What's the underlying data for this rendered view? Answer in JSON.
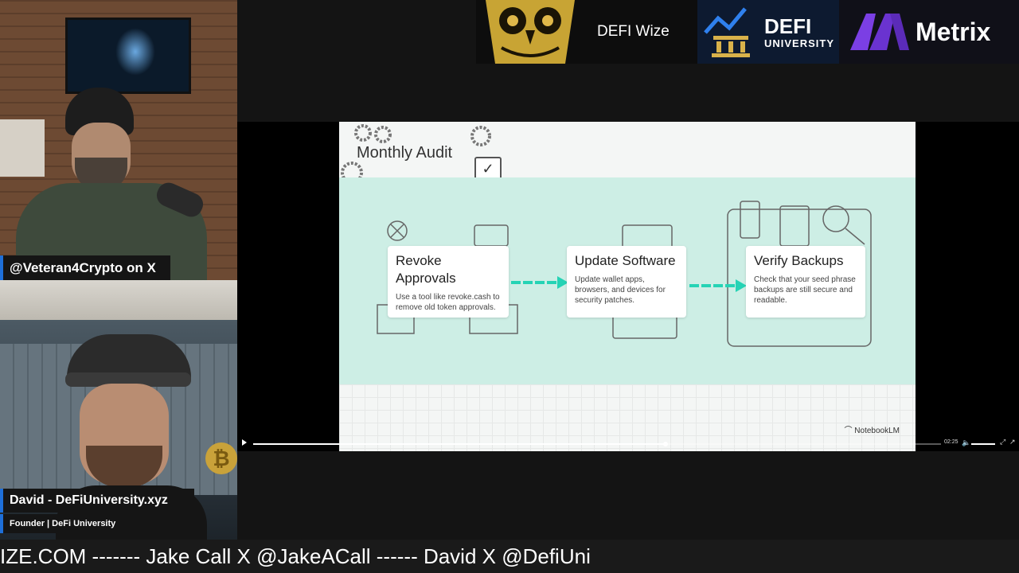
{
  "cameras": {
    "top_label": "@Veteran4Crypto on X",
    "bottom_name": "David - DeFiUniversity.xyz",
    "bottom_title": "Founder | DeFi University"
  },
  "sponsors": {
    "defi_wize": "DEFI Wize",
    "defi_university_line1": "DEFI",
    "defi_university_line2": "UNIVERSITY",
    "metrix": "Metrix"
  },
  "slide": {
    "title": "Monthly Audit",
    "steps": [
      {
        "title": "Revoke Approvals",
        "text": "Use a tool like revoke.cash to remove old token approvals."
      },
      {
        "title": "Update Software",
        "text": "Update wallet apps, browsers, and devices for security patches."
      },
      {
        "title": "Verify Backups",
        "text": "Check that your seed phrase backups are still secure and readable."
      }
    ],
    "watermark": "NotebookLM"
  },
  "player": {
    "time": "02:25",
    "progress": 0.6
  },
  "ticker": "IZE.COM ------- Jake Call X @JakeACall ------ David X @DefiUni"
}
